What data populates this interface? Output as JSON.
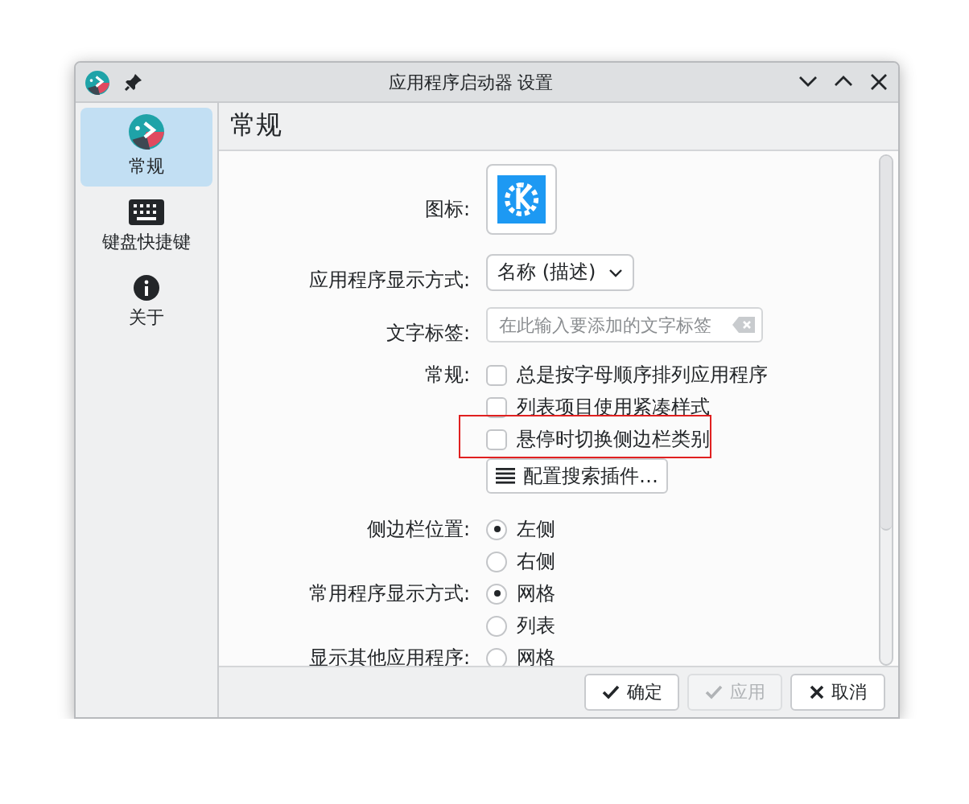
{
  "window": {
    "title": "应用程序启动器 设置"
  },
  "sidebar": {
    "items": [
      {
        "label": "常规",
        "selected": true
      },
      {
        "label": "键盘快捷键",
        "selected": false
      },
      {
        "label": "关于",
        "selected": false
      }
    ]
  },
  "page": {
    "title": "常规"
  },
  "sections": [
    [
      {
        "kind": "icon",
        "label": "图标:"
      },
      {
        "kind": "combo",
        "label": "应用程序显示方式:",
        "value": "名称 (描述)"
      },
      {
        "kind": "text",
        "label": "文字标签:",
        "placeholder": "在此输入要添加的文字标签"
      },
      {
        "kind": "check",
        "label": "常规:",
        "text": "总是按字母顺序排列应用程序",
        "checked": false,
        "highlighted": false
      },
      {
        "kind": "check",
        "text": "列表项目使用紧凑样式",
        "checked": false,
        "highlighted": false
      },
      {
        "kind": "check",
        "text": "悬停时切换侧边栏类别",
        "checked": false,
        "highlighted": true
      },
      {
        "kind": "button",
        "text": "配置搜索插件…"
      }
    ],
    [
      {
        "kind": "radio",
        "label": "侧边栏位置:",
        "text": "左侧",
        "selected": true
      },
      {
        "kind": "radio",
        "text": "右侧",
        "selected": false
      },
      {
        "kind": "radio",
        "label": "常用程序显示方式:",
        "text": "网格",
        "selected": true
      },
      {
        "kind": "radio",
        "text": "列表",
        "selected": false
      },
      {
        "kind": "radio",
        "label": "显示其他应用程序:",
        "text": "网格",
        "selected": false
      }
    ]
  ],
  "buttons": [
    {
      "label": "确定",
      "disabled": false
    },
    {
      "label": "应用",
      "disabled": true
    },
    {
      "label": "取消",
      "disabled": false
    }
  ]
}
